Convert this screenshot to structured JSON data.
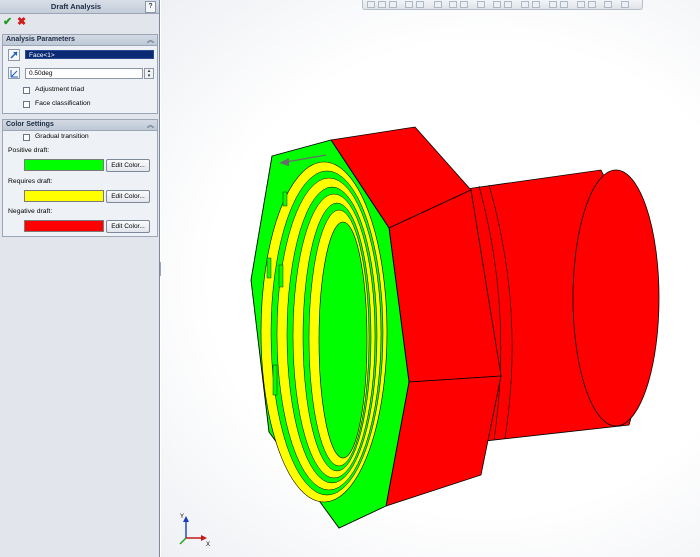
{
  "panel": {
    "title": "Draft Analysis",
    "help": "?",
    "ok_symbol": "✔",
    "cancel_symbol": "✖",
    "analysis_params": {
      "heading": "Analysis Parameters",
      "face_value": "Face<1>",
      "angle_value": "0.50deg",
      "adjustment_triad": "Adjustment triad",
      "face_classification": "Face classification"
    },
    "color_settings": {
      "heading": "Color Settings",
      "gradual_transition": "Gradual transition",
      "positive_label": "Positive draft:",
      "requires_label": "Requires draft:",
      "negative_label": "Negative draft:",
      "edit_color": "Edit Color...",
      "positive_color": "#00ff00",
      "requires_color": "#ffff00",
      "negative_color": "#ff0000"
    }
  },
  "triad": {
    "x_label": "X",
    "y_label": "Y"
  }
}
